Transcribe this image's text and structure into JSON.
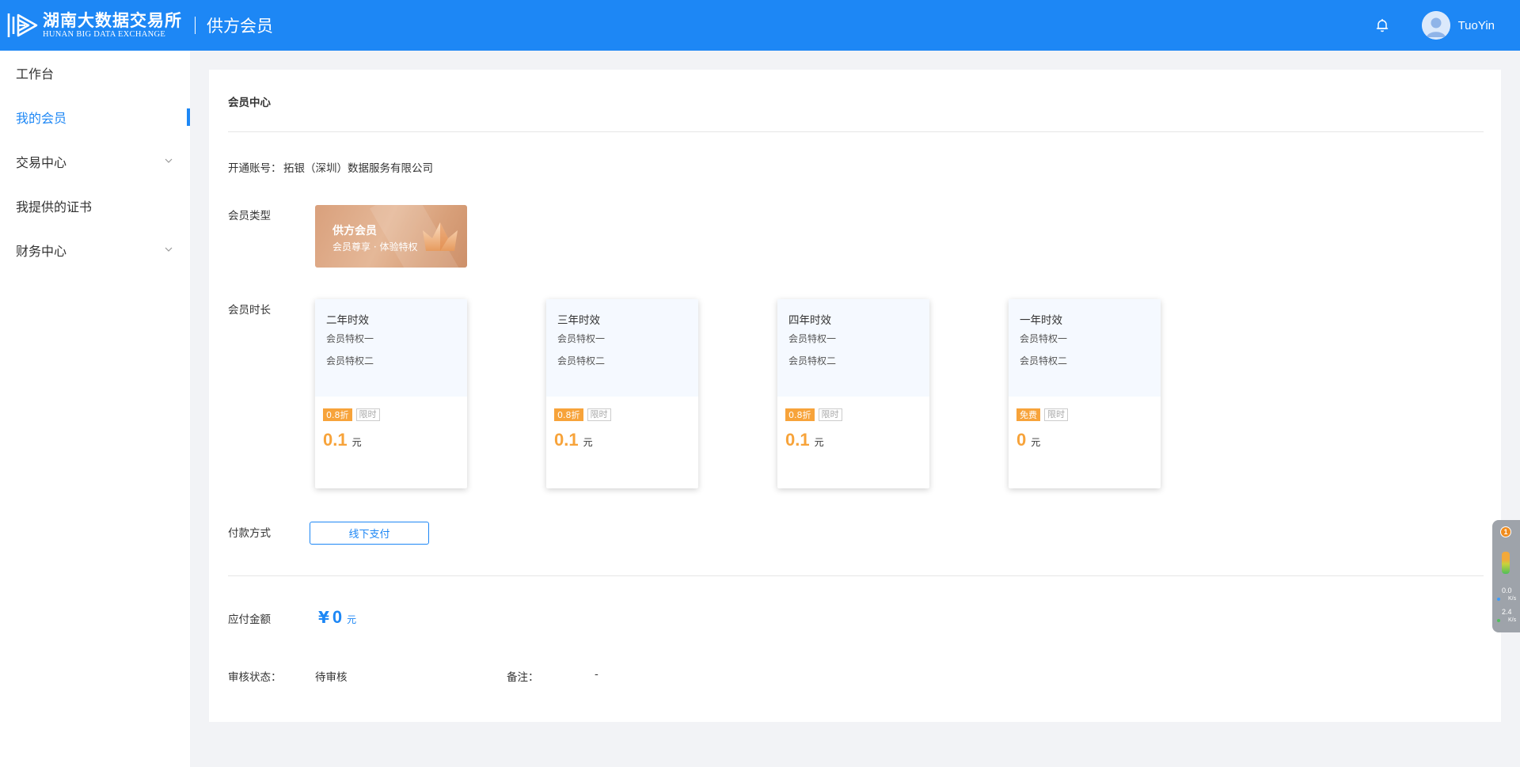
{
  "header": {
    "logo_cn": "湖南大数据交易所",
    "logo_en": "HUNAN BIG DATA EXCHANGE",
    "app_title": "供方会员",
    "username": "TuoYin",
    "bell_icon": "bell-icon",
    "avatar_icon": "user-avatar-icon"
  },
  "sidebar": {
    "items": [
      {
        "label": "工作台",
        "active": false,
        "expandable": false
      },
      {
        "label": "我的会员",
        "active": true,
        "expandable": false
      },
      {
        "label": "交易中心",
        "active": false,
        "expandable": true
      },
      {
        "label": "我提供的证书",
        "active": false,
        "expandable": false
      },
      {
        "label": "财务中心",
        "active": false,
        "expandable": true
      }
    ]
  },
  "main": {
    "title": "会员中心",
    "account_label": "开通账号：",
    "account_value": "拓银（深圳）数据服务有限公司",
    "member_type_label": "会员类型",
    "member_type": {
      "name": "供方会员",
      "desc": "会员尊享 · 体验特权"
    },
    "duration_label": "会员时长",
    "plans": [
      {
        "name": "二年时效",
        "perks": [
          "会员特权一",
          "会员特权二"
        ],
        "tag": "0.8折",
        "limit": "限时",
        "price": "0.1",
        "unit": "元"
      },
      {
        "name": "三年时效",
        "perks": [
          "会员特权一",
          "会员特权二"
        ],
        "tag": "0.8折",
        "limit": "限时",
        "price": "0.1",
        "unit": "元"
      },
      {
        "name": "四年时效",
        "perks": [
          "会员特权一",
          "会员特权二"
        ],
        "tag": "0.8折",
        "limit": "限时",
        "price": "0.1",
        "unit": "元"
      },
      {
        "name": "一年时效",
        "perks": [
          "会员特权一",
          "会员特权二"
        ],
        "tag": "免费",
        "limit": "限时",
        "price": "0",
        "unit": "元"
      }
    ],
    "payment_label": "付款方式",
    "payment_button": "线下支付",
    "amount_label": "应付金额",
    "amount_symbol": "¥",
    "amount_value": "0",
    "amount_unit": "元",
    "audit_label": "审核状态：",
    "audit_value": "待审核",
    "remark_label": "备注：",
    "remark_value": "-"
  },
  "widget": {
    "badge": "1",
    "upload": "0.0",
    "upload_unit": "K/s",
    "download": "2.4",
    "download_unit": "K/s"
  },
  "colors": {
    "primary": "#1d87f5",
    "accent_orange": "#f7a33a",
    "page_bg": "#f2f3f6"
  }
}
